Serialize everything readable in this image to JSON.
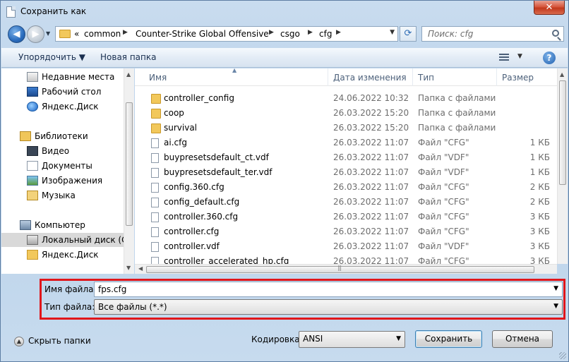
{
  "window": {
    "title": "Сохранить как",
    "close_symbol": "✕"
  },
  "nav": {
    "back_symbol": "◀",
    "forward_symbol": "▶"
  },
  "address": {
    "prefix": "«",
    "segments": [
      "common",
      "Counter-Strike Global Offensive",
      "csgo",
      "cfg"
    ]
  },
  "search": {
    "placeholder": "Поиск: cfg"
  },
  "toolbar": {
    "organize": "Упорядочить ▼",
    "new_folder": "Новая папка",
    "help": "?"
  },
  "sidebar": {
    "items": [
      {
        "label": "Недавние места",
        "icon": "recent-places-icon"
      },
      {
        "label": "Рабочий стол",
        "icon": "desktop-icon"
      },
      {
        "label": "Яндекс.Диск",
        "icon": "yandex-disk-icon"
      },
      {
        "label": "Библиотеки",
        "icon": "libraries-icon"
      },
      {
        "label": "Видео",
        "icon": "video-icon"
      },
      {
        "label": "Документы",
        "icon": "documents-icon"
      },
      {
        "label": "Изображения",
        "icon": "images-icon"
      },
      {
        "label": "Музыка",
        "icon": "music-icon"
      },
      {
        "label": "Компьютер",
        "icon": "computer-icon"
      },
      {
        "label": "Локальный диск (C:)",
        "icon": "local-disk-icon",
        "selected": true
      },
      {
        "label": "Яндекс.Диск",
        "icon": "yandex-folder-icon"
      }
    ]
  },
  "files": {
    "columns": [
      "Имя",
      "Дата изменения",
      "Тип",
      "Размер"
    ],
    "rows": [
      {
        "name": "controller_config",
        "date": "24.06.2022 10:32",
        "type": "Папка с файлами",
        "size": "",
        "kind": "folder"
      },
      {
        "name": "coop",
        "date": "26.03.2022 15:20",
        "type": "Папка с файлами",
        "size": "",
        "kind": "folder"
      },
      {
        "name": "survival",
        "date": "26.03.2022 15:20",
        "type": "Папка с файлами",
        "size": "",
        "kind": "folder"
      },
      {
        "name": "ai.cfg",
        "date": "26.03.2022 11:07",
        "type": "Файл \"CFG\"",
        "size": "1 КБ",
        "kind": "file"
      },
      {
        "name": "buypresetsdefault_ct.vdf",
        "date": "26.03.2022 11:07",
        "type": "Файл \"VDF\"",
        "size": "1 КБ",
        "kind": "file"
      },
      {
        "name": "buypresetsdefault_ter.vdf",
        "date": "26.03.2022 11:07",
        "type": "Файл \"VDF\"",
        "size": "1 КБ",
        "kind": "file"
      },
      {
        "name": "config.360.cfg",
        "date": "26.03.2022 11:07",
        "type": "Файл \"CFG\"",
        "size": "2 КБ",
        "kind": "file"
      },
      {
        "name": "config_default.cfg",
        "date": "26.03.2022 11:07",
        "type": "Файл \"CFG\"",
        "size": "2 КБ",
        "kind": "file"
      },
      {
        "name": "controller.360.cfg",
        "date": "26.03.2022 11:07",
        "type": "Файл \"CFG\"",
        "size": "3 КБ",
        "kind": "file"
      },
      {
        "name": "controller.cfg",
        "date": "26.03.2022 11:07",
        "type": "Файл \"CFG\"",
        "size": "3 КБ",
        "kind": "file"
      },
      {
        "name": "controller.vdf",
        "date": "26.03.2022 11:07",
        "type": "Файл \"VDF\"",
        "size": "3 КБ",
        "kind": "file"
      },
      {
        "name": "controller_accelerated_hp.cfg",
        "date": "26.03.2022 11:07",
        "type": "Файл \"CFG\"",
        "size": "3 КБ",
        "kind": "file"
      }
    ]
  },
  "save_form": {
    "filename_label": "Имя файла:",
    "filename_value": "fps.cfg",
    "filetype_label": "Тип файла:",
    "filetype_value": "Все файлы  (*.*)"
  },
  "footer": {
    "hide_folders": "Скрыть папки",
    "encoding_label": "Кодировка:",
    "encoding_value": "ANSI",
    "save_button": "Сохранить",
    "cancel_button": "Отмена"
  },
  "colors": {
    "highlight_box": "#e0161b",
    "window_frame": "#b9d1ea"
  }
}
